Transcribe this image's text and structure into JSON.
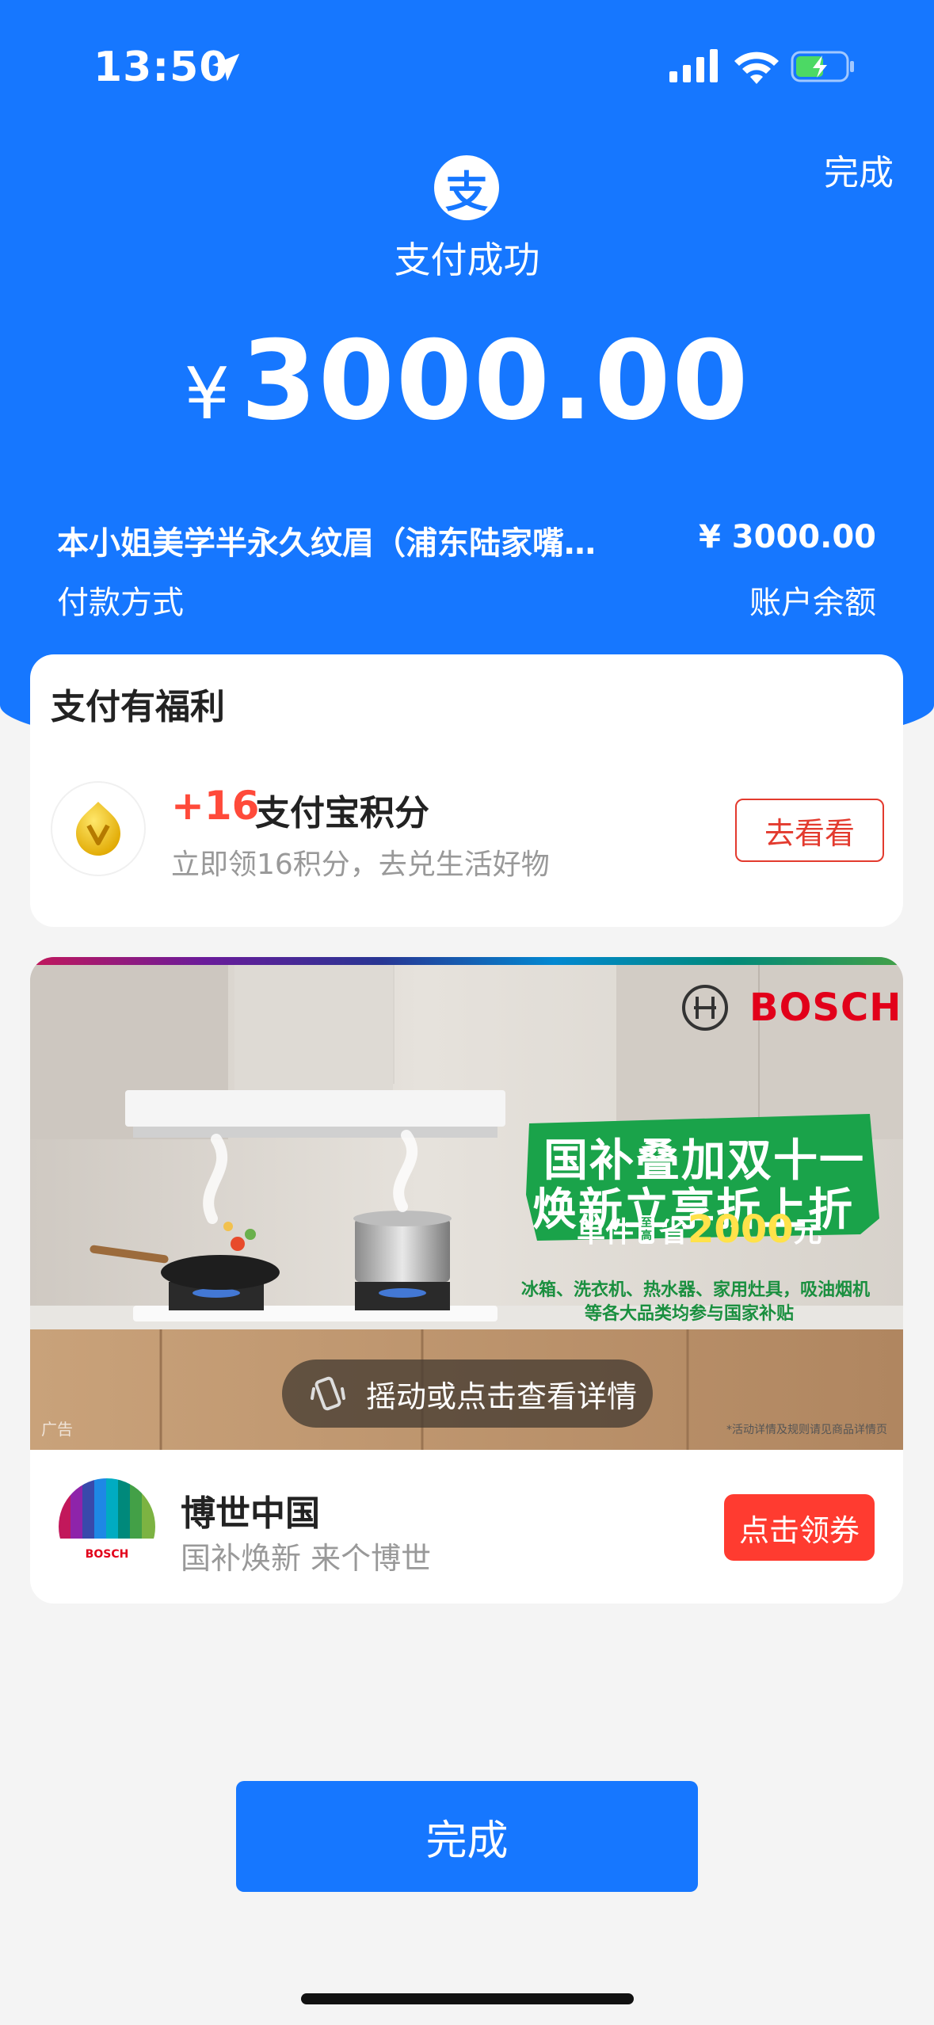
{
  "status_bar": {
    "time": "13:50"
  },
  "header": {
    "done_label": "完成",
    "logo_char": "支",
    "status_text": "支付成功",
    "currency_symbol": "¥",
    "amount": "3000.00"
  },
  "details": {
    "merchant": "本小姐美学半永久纹眉（浦东陆家嘴…",
    "merchant_amount": "¥ 3000.00",
    "payment_method_label": "付款方式",
    "payment_method_value": "账户余额"
  },
  "benefits": {
    "title": "支付有福利",
    "points_plus": "+16",
    "points_name": "支付宝积分",
    "points_desc": "立即领16积分，去兑生活好物",
    "button_label": "去看看"
  },
  "ad": {
    "banner": {
      "brand_logo_text": "BOSCH",
      "headline_1": "国补叠加双十一",
      "headline_2": "焕新立享折上折",
      "offer_prefix": "单件",
      "offer_tag": "至高",
      "offer_mid": "省",
      "offer_amount": "2000",
      "offer_suffix": "元",
      "sub_1": "冰箱、洗衣机、热水器、家用灶具，吸油烟机",
      "sub_2": "等各大品类均参与国家补贴",
      "shake_hint": "摇动或点击查看详情",
      "ad_label": "广告",
      "disclaimer": "*活动详情及规则请见商品详情页"
    },
    "brand_name": "博世中国",
    "slogan": "国补焕新 来个博世",
    "logo_text": "BOSCH",
    "coupon_button": "点击领券"
  },
  "footer": {
    "done_label": "完成"
  },
  "colors": {
    "alipay_blue": "#1677ff",
    "points_red": "#ff4a3a",
    "coupon_red": "#ff3b30",
    "ad_green": "#1aa34a"
  }
}
